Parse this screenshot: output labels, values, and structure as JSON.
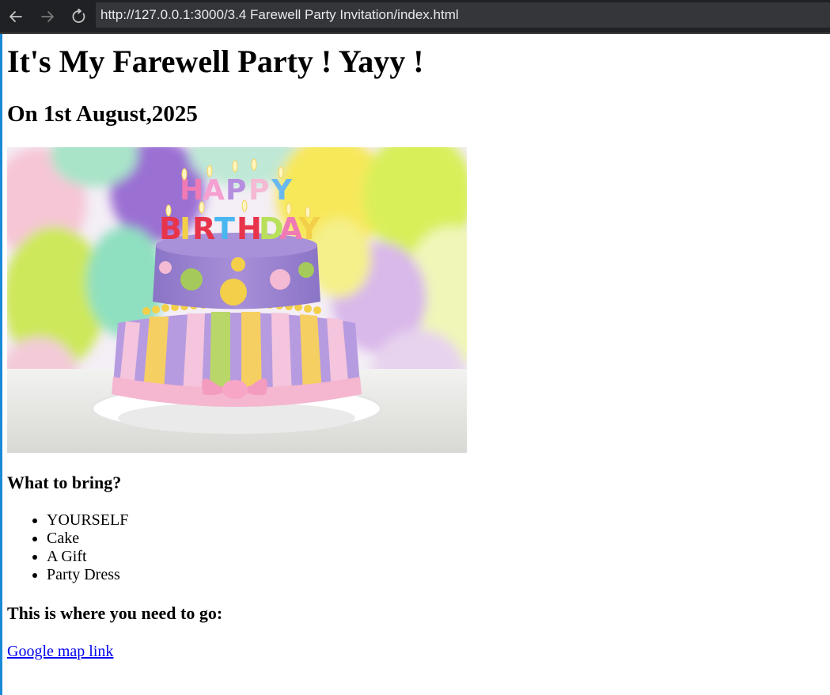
{
  "browser": {
    "url": "http://127.0.0.1:3000/3.4 Farewell Party Invitation/index.html",
    "icons": {
      "back": "arrow-left-icon",
      "forward": "arrow-right-icon",
      "reload": "reload-icon"
    },
    "colors": {
      "toolbar_bg": "#202124",
      "address_bg": "#35363a",
      "address_text": "#e8eaed",
      "left_edge": "#1a8ad8"
    }
  },
  "page": {
    "title": "It's My Farewell Party ! Yayy !",
    "date_heading": "On 1st August,2025",
    "cake_image": {
      "candle_letters_row1": [
        "H",
        "A",
        "P",
        "P",
        "Y"
      ],
      "candle_letters_row2": [
        "B",
        "I",
        "R",
        "T",
        "H",
        "D",
        "A",
        "Y"
      ]
    },
    "bring_heading": "What to bring?",
    "bring_items": [
      "YOURSELF",
      "Cake",
      "A Gift",
      "Party Dress"
    ],
    "where_heading": "This is where you need to go:",
    "map_link_label": "Google map link",
    "link_color": "#0000ee"
  }
}
